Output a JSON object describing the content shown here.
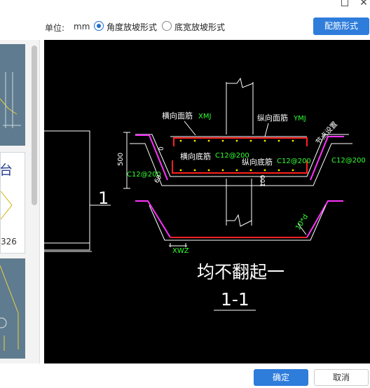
{
  "toolbar": {
    "unit_label": "单位:",
    "unit_value": "mm",
    "radio_angle_label": "角度放坡形式",
    "radio_bottom_label": "底宽放坡形式",
    "config_button": "配筋形式"
  },
  "thumbnails": {
    "thumb2_text_top": "台",
    "thumb2_text_bottom": "326"
  },
  "drawing": {
    "labels": {
      "transverse_top": "横向面筋",
      "transverse_top_code": "XMJ",
      "longitudinal_top": "纵向面筋",
      "longitudinal_top_code": "YMJ",
      "transverse_bottom": "横向底筋",
      "transverse_bottom_spec": "C12@200",
      "longitudinal_bottom": "纵向底筋",
      "longitudinal_bottom_spec": "C12@200",
      "node_setting": "节点设置",
      "left_dim": "500",
      "left_spec": "C12@200",
      "right_spec": "C12@200",
      "zero_dim": "0",
      "angle_dim": "60",
      "hundred_dim": "100",
      "section_number": "1",
      "ten_d": "10*d",
      "xwz": "XWZ",
      "no_bend_note": "均不翻起一",
      "section_title": "1-1"
    }
  },
  "footer": {
    "ok_button": "确定",
    "cancel_button": "取消"
  }
}
